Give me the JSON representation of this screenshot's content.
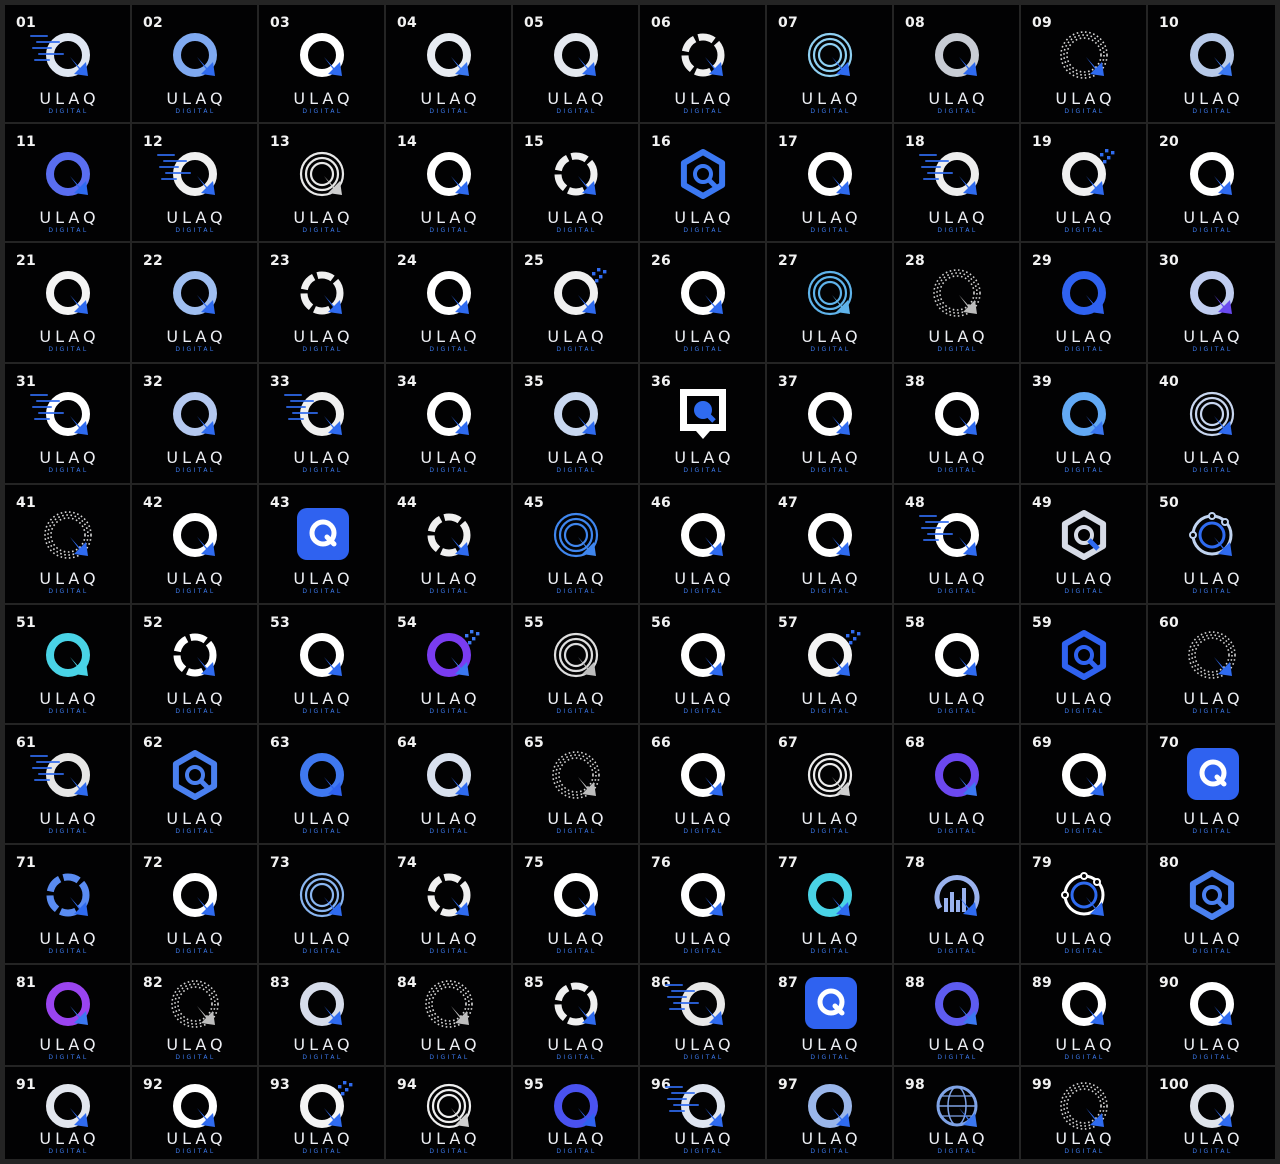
{
  "brand": {
    "wordmark": "ULAQ",
    "tagline": "DIGITAL"
  },
  "colors": {
    "background": "#020203",
    "grid_lines": "#242424",
    "number": "#f2f2f2",
    "wordmark": "#eceef3",
    "tagline": "#3d7cf2",
    "accent_blue": "#2f6bf0",
    "light_blue": "#62a9f4",
    "cyan": "#49d3e6",
    "purple": "#7a3cf0",
    "silver": "#c8ccd4"
  },
  "grid": {
    "columns": 10,
    "rows": 10
  },
  "icon_legend": {
    "solid": "q-letter-icon",
    "motion": "q-letter-motion-lines-icon",
    "dotted": "q-letter-dotted-icon",
    "concentric": "q-letter-concentric-rings-icon",
    "segmented": "q-letter-segmented-icon",
    "hexagon": "q-letter-hexagon-icon",
    "app": "q-app-tile-icon",
    "bubble": "q-speech-bubble-icon",
    "pixels": "q-letter-pixels-icon",
    "bars": "q-letter-bar-chart-icon",
    "globe": "q-letter-globe-icon",
    "nodes": "q-letter-nodes-icon"
  },
  "logos": [
    {
      "label": "01",
      "style": "motion",
      "ring": "#dfe6f2",
      "tail": "#2f6bf0"
    },
    {
      "label": "02",
      "style": "solid",
      "ring": "#7fa9f0",
      "tail": "#2f6bf0"
    },
    {
      "label": "03",
      "style": "solid",
      "ring": "#ffffff",
      "tail": "#2f6bf0"
    },
    {
      "label": "04",
      "style": "solid",
      "ring": "#e8ecf2",
      "tail": "#3b78f2"
    },
    {
      "label": "05",
      "style": "solid",
      "ring": "#e4e8ef",
      "tail": "#2f6bf0"
    },
    {
      "label": "06",
      "style": "segmented",
      "ring": "#f0f0f0",
      "tail": "#2f6bf0"
    },
    {
      "label": "07",
      "style": "concentric",
      "ring": "#8fd0f2",
      "tail": "#2f6bf0"
    },
    {
      "label": "08",
      "style": "solid",
      "ring": "#c8ccd4",
      "tail": "#2f6bf0"
    },
    {
      "label": "09",
      "style": "dotted",
      "ring": "#d8d8d8",
      "tail": "#2f6bf0"
    },
    {
      "label": "10",
      "style": "solid",
      "ring": "#b7c9e8",
      "tail": "#3b78f2"
    },
    {
      "label": "11",
      "style": "solid",
      "ring": "#5a6ef0",
      "tail": "#2f6bf0"
    },
    {
      "label": "12",
      "style": "motion",
      "ring": "#f0f0f0",
      "tail": "#2f6bf0"
    },
    {
      "label": "13",
      "style": "concentric",
      "ring": "#e8e8e8",
      "tail": "#cfcfcf"
    },
    {
      "label": "14",
      "style": "solid",
      "ring": "#ffffff",
      "tail": "#2f6bf0"
    },
    {
      "label": "15",
      "style": "segmented",
      "ring": "#f0f0f0",
      "tail": "#2f6bf0"
    },
    {
      "label": "16",
      "style": "hexagon",
      "ring": "#3b78f2",
      "tail": "#3b78f2"
    },
    {
      "label": "17",
      "style": "solid",
      "ring": "#ffffff",
      "tail": "#2f6bf0"
    },
    {
      "label": "18",
      "style": "motion",
      "ring": "#eeeeee",
      "tail": "#2f6bf0"
    },
    {
      "label": "19",
      "style": "pixels",
      "ring": "#f0f0f0",
      "tail": "#2f6bf0"
    },
    {
      "label": "20",
      "style": "solid",
      "ring": "#ffffff",
      "tail": "#2f6bf0"
    },
    {
      "label": "21",
      "style": "solid",
      "ring": "#f4f4f4",
      "tail": "#2f6bf0"
    },
    {
      "label": "22",
      "style": "solid",
      "ring": "#9fbef0",
      "tail": "#2f6bf0"
    },
    {
      "label": "23",
      "style": "segmented",
      "ring": "#f0f0f0",
      "tail": "#2f6bf0"
    },
    {
      "label": "24",
      "style": "solid",
      "ring": "#ffffff",
      "tail": "#2f6bf0"
    },
    {
      "label": "25",
      "style": "pixels",
      "ring": "#f0f0f0",
      "tail": "#2f6bf0"
    },
    {
      "label": "26",
      "style": "solid",
      "ring": "#ffffff",
      "tail": "#2f6bf0"
    },
    {
      "label": "27",
      "style": "concentric",
      "ring": "#5fb3ea",
      "tail": "#5fb3ea"
    },
    {
      "label": "28",
      "style": "dotted",
      "ring": "#d0d0d0",
      "tail": "#bdbdbd"
    },
    {
      "label": "29",
      "style": "solid",
      "ring": "#2f62f0",
      "tail": "#2f62f0"
    },
    {
      "label": "30",
      "style": "solid",
      "ring": "#c0cdf0",
      "tail": "#6a4af0"
    },
    {
      "label": "31",
      "style": "motion",
      "ring": "#ffffff",
      "tail": "#2f6bf0"
    },
    {
      "label": "32",
      "style": "solid",
      "ring": "#b4c8ef",
      "tail": "#2f6bf0"
    },
    {
      "label": "33",
      "style": "motion",
      "ring": "#f0f0f0",
      "tail": "#2f6bf0"
    },
    {
      "label": "34",
      "style": "solid",
      "ring": "#ffffff",
      "tail": "#2f6bf0"
    },
    {
      "label": "35",
      "style": "solid",
      "ring": "#c9d8f0",
      "tail": "#2f6bf0"
    },
    {
      "label": "36",
      "style": "bubble",
      "ring": "#ffffff",
      "tail": "#2f6bf0"
    },
    {
      "label": "37",
      "style": "solid",
      "ring": "#ffffff",
      "tail": "#2f6bf0"
    },
    {
      "label": "38",
      "style": "solid",
      "ring": "#ffffff",
      "tail": "#2f6bf0"
    },
    {
      "label": "39",
      "style": "solid",
      "ring": "#62a9f4",
      "tail": "#3b78f2"
    },
    {
      "label": "40",
      "style": "concentric",
      "ring": "#c8d6ef",
      "tail": "#2f6bf0"
    },
    {
      "label": "41",
      "style": "dotted",
      "ring": "#d8d8d8",
      "tail": "#2f6bf0"
    },
    {
      "label": "42",
      "style": "solid",
      "ring": "#ffffff",
      "tail": "#2f6bf0"
    },
    {
      "label": "43",
      "style": "app",
      "ring": "#ffffff",
      "tail": "#2f62f0"
    },
    {
      "label": "44",
      "style": "segmented",
      "ring": "#f0f0f0",
      "tail": "#2f6bf0"
    },
    {
      "label": "45",
      "style": "concentric",
      "ring": "#3f86ee",
      "tail": "#3f86ee"
    },
    {
      "label": "46",
      "style": "solid",
      "ring": "#ffffff",
      "tail": "#2f6bf0"
    },
    {
      "label": "47",
      "style": "solid",
      "ring": "#ffffff",
      "tail": "#2f6bf0"
    },
    {
      "label": "48",
      "style": "motion",
      "ring": "#ffffff",
      "tail": "#2f6bf0"
    },
    {
      "label": "49",
      "style": "hexagon",
      "ring": "#d6dbe6",
      "tail": "#2f6bf0"
    },
    {
      "label": "50",
      "style": "nodes",
      "ring": "#c0d3f0",
      "tail": "#2f6bf0"
    },
    {
      "label": "51",
      "style": "solid",
      "ring": "#49d3e6",
      "tail": "#49d3e6"
    },
    {
      "label": "52",
      "style": "segmented",
      "ring": "#ffffff",
      "tail": "#2f6bf0"
    },
    {
      "label": "53",
      "style": "solid",
      "ring": "#ffffff",
      "tail": "#2f6bf0"
    },
    {
      "label": "54",
      "style": "pixels",
      "ring": "#7a3cf0",
      "tail": "#3b78f2"
    },
    {
      "label": "55",
      "style": "concentric",
      "ring": "#dedede",
      "tail": "#bdbdbd"
    },
    {
      "label": "56",
      "style": "solid",
      "ring": "#ffffff",
      "tail": "#2f6bf0"
    },
    {
      "label": "57",
      "style": "pixels",
      "ring": "#f4f4f4",
      "tail": "#2f6bf0"
    },
    {
      "label": "58",
      "style": "solid",
      "ring": "#ffffff",
      "tail": "#2f6bf0"
    },
    {
      "label": "59",
      "style": "hexagon",
      "ring": "#2f62f0",
      "tail": "#2f62f0"
    },
    {
      "label": "60",
      "style": "dotted",
      "ring": "#cfcfcf",
      "tail": "#2f6bf0"
    },
    {
      "label": "61",
      "style": "motion",
      "ring": "#e6e6e6",
      "tail": "#2f6bf0"
    },
    {
      "label": "62",
      "style": "hexagon",
      "ring": "#4a80f0",
      "tail": "#4a80f0"
    },
    {
      "label": "63",
      "style": "solid",
      "ring": "#3f78f0",
      "tail": "#2f62f0"
    },
    {
      "label": "64",
      "style": "solid",
      "ring": "#d8e0ee",
      "tail": "#2f6bf0"
    },
    {
      "label": "65",
      "style": "dotted",
      "ring": "#d2d2d2",
      "tail": "#bdbdbd"
    },
    {
      "label": "66",
      "style": "solid",
      "ring": "#ffffff",
      "tail": "#2f6bf0"
    },
    {
      "label": "67",
      "style": "concentric",
      "ring": "#ececec",
      "tail": "#cfcfcf"
    },
    {
      "label": "68",
      "style": "solid",
      "ring": "#6c48f0",
      "tail": "#3b78f2"
    },
    {
      "label": "69",
      "style": "solid",
      "ring": "#ffffff",
      "tail": "#2f6bf0"
    },
    {
      "label": "70",
      "style": "app",
      "ring": "#ffffff",
      "tail": "#2f62f0"
    },
    {
      "label": "71",
      "style": "segmented",
      "ring": "#5a8cf2",
      "tail": "#2f6bf0"
    },
    {
      "label": "72",
      "style": "solid",
      "ring": "#ffffff",
      "tail": "#2f6bf0"
    },
    {
      "label": "73",
      "style": "concentric",
      "ring": "#8ab6f0",
      "tail": "#2f6bf0"
    },
    {
      "label": "74",
      "style": "segmented",
      "ring": "#f0f0f0",
      "tail": "#2f6bf0"
    },
    {
      "label": "75",
      "style": "solid",
      "ring": "#ffffff",
      "tail": "#2f6bf0"
    },
    {
      "label": "76",
      "style": "solid",
      "ring": "#ffffff",
      "tail": "#2f6bf0"
    },
    {
      "label": "77",
      "style": "solid",
      "ring": "#49d3e6",
      "tail": "#2f6bf0"
    },
    {
      "label": "78",
      "style": "bars",
      "ring": "#9ab2ee",
      "tail": "#2f6bf0"
    },
    {
      "label": "79",
      "style": "nodes",
      "ring": "#ffffff",
      "tail": "#2f6bf0"
    },
    {
      "label": "80",
      "style": "hexagon",
      "ring": "#4a80f0",
      "tail": "#4a80f0"
    },
    {
      "label": "81",
      "style": "solid",
      "ring": "#9a44f0",
      "tail": "#3b78f2"
    },
    {
      "label": "82",
      "style": "dotted",
      "ring": "#d4d4d4",
      "tail": "#bdbdbd"
    },
    {
      "label": "83",
      "style": "solid",
      "ring": "#d6dcea",
      "tail": "#2f6bf0"
    },
    {
      "label": "84",
      "style": "dotted",
      "ring": "#dadada",
      "tail": "#bdbdbd"
    },
    {
      "label": "85",
      "style": "segmented",
      "ring": "#f0f0f0",
      "tail": "#2f6bf0"
    },
    {
      "label": "86",
      "style": "motion",
      "ring": "#e8e8e8",
      "tail": "#2f6bf0"
    },
    {
      "label": "87",
      "style": "app",
      "ring": "#ffffff",
      "tail": "#2f62f0"
    },
    {
      "label": "88",
      "style": "solid",
      "ring": "#5e5cf0",
      "tail": "#3b78f2"
    },
    {
      "label": "89",
      "style": "solid",
      "ring": "#ffffff",
      "tail": "#2f6bf0"
    },
    {
      "label": "90",
      "style": "solid",
      "ring": "#ffffff",
      "tail": "#2f6bf0"
    },
    {
      "label": "91",
      "style": "solid",
      "ring": "#e2e6ee",
      "tail": "#2f6bf0"
    },
    {
      "label": "92",
      "style": "solid",
      "ring": "#ffffff",
      "tail": "#2f6bf0"
    },
    {
      "label": "93",
      "style": "pixels",
      "ring": "#f4f4f4",
      "tail": "#2f6bf0"
    },
    {
      "label": "94",
      "style": "concentric",
      "ring": "#eeeeee",
      "tail": "#cfcfcf"
    },
    {
      "label": "95",
      "style": "solid",
      "ring": "#4a52f0",
      "tail": "#2f62f0"
    },
    {
      "label": "96",
      "style": "motion",
      "ring": "#dfe5f0",
      "tail": "#2f6bf0"
    },
    {
      "label": "97",
      "style": "solid",
      "ring": "#9ab6ea",
      "tail": "#2f6bf0"
    },
    {
      "label": "98",
      "style": "globe",
      "ring": "#7fa3e6",
      "tail": "#3b78f2"
    },
    {
      "label": "99",
      "style": "dotted",
      "ring": "#d4d4d4",
      "tail": "#2f6bf0"
    },
    {
      "label": "100",
      "style": "solid",
      "ring": "#dfe3ea",
      "tail": "#2f6bf0"
    }
  ]
}
